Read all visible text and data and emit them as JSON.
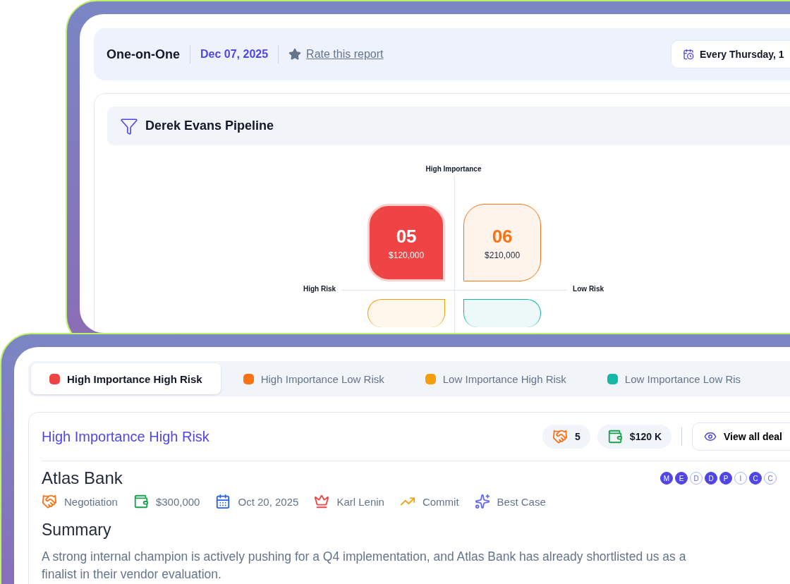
{
  "report_header": {
    "title": "One-on-One",
    "date": "Dec 07, 2025",
    "rate_link": "Rate this report",
    "schedule": "Every Thursday, 1"
  },
  "pipeline": {
    "title": "Derek Evans Pipeline",
    "axis_top": "High Importance",
    "axis_left": "High Risk",
    "axis_right": "Low Risk",
    "quadrants": [
      {
        "count": "05",
        "amount": "$120,000",
        "color": "#ef4444",
        "selected": true
      },
      {
        "count": "06",
        "amount": "$210,000",
        "color": "#f97316",
        "selected": false
      },
      {
        "color": "#f59e0b",
        "selected": false
      },
      {
        "color": "#14b8a6",
        "selected": false
      }
    ]
  },
  "tabs": [
    {
      "label": "High Importance High Risk",
      "color": "#ef4444",
      "selected": true
    },
    {
      "label": "High Importance Low Risk",
      "color": "#f97316",
      "selected": false
    },
    {
      "label": "Low Importance High Risk",
      "color": "#f59e0b",
      "selected": false
    },
    {
      "label": "Low Importance Low Ris",
      "color": "#14b8a6",
      "selected": false
    }
  ],
  "group": {
    "title": "High Importance High Risk",
    "deal_count": "5",
    "total": "$120 K",
    "view_button": "View all deal"
  },
  "deal": {
    "name": "Atlas Bank",
    "meddpicc": [
      {
        "letter": "M",
        "met": true
      },
      {
        "letter": "E",
        "met": true
      },
      {
        "letter": "D",
        "met": false
      },
      {
        "letter": "D",
        "met": true
      },
      {
        "letter": "P",
        "met": true
      },
      {
        "letter": "I",
        "met": false
      },
      {
        "letter": "C",
        "met": true
      },
      {
        "letter": "C",
        "met": false
      }
    ],
    "details": [
      {
        "kind": "stage",
        "text": "Negotiation"
      },
      {
        "kind": "amount",
        "text": "$300,000"
      },
      {
        "kind": "date",
        "text": "Oct 20, 2025"
      },
      {
        "kind": "owner",
        "text": "Karl Lenin"
      },
      {
        "kind": "forecast",
        "text": "Commit"
      },
      {
        "kind": "scenario",
        "text": "Best Case"
      }
    ],
    "summary_heading": "Summary",
    "summary": "A strong internal champion is actively pushing for a Q4 implementation, and Atlas Bank has already shortlisted us as a\nfinalist in their vendor evaluation."
  }
}
